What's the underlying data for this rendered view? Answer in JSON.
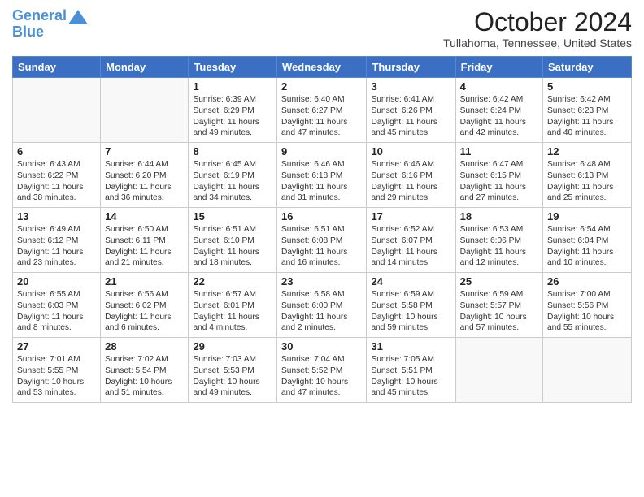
{
  "logo": {
    "line1": "General",
    "line2": "Blue"
  },
  "title": "October 2024",
  "location": "Tullahoma, Tennessee, United States",
  "days_of_week": [
    "Sunday",
    "Monday",
    "Tuesday",
    "Wednesday",
    "Thursday",
    "Friday",
    "Saturday"
  ],
  "weeks": [
    [
      {
        "day": "",
        "info": ""
      },
      {
        "day": "",
        "info": ""
      },
      {
        "day": "1",
        "info": "Sunrise: 6:39 AM\nSunset: 6:29 PM\nDaylight: 11 hours and 49 minutes."
      },
      {
        "day": "2",
        "info": "Sunrise: 6:40 AM\nSunset: 6:27 PM\nDaylight: 11 hours and 47 minutes."
      },
      {
        "day": "3",
        "info": "Sunrise: 6:41 AM\nSunset: 6:26 PM\nDaylight: 11 hours and 45 minutes."
      },
      {
        "day": "4",
        "info": "Sunrise: 6:42 AM\nSunset: 6:24 PM\nDaylight: 11 hours and 42 minutes."
      },
      {
        "day": "5",
        "info": "Sunrise: 6:42 AM\nSunset: 6:23 PM\nDaylight: 11 hours and 40 minutes."
      }
    ],
    [
      {
        "day": "6",
        "info": "Sunrise: 6:43 AM\nSunset: 6:22 PM\nDaylight: 11 hours and 38 minutes."
      },
      {
        "day": "7",
        "info": "Sunrise: 6:44 AM\nSunset: 6:20 PM\nDaylight: 11 hours and 36 minutes."
      },
      {
        "day": "8",
        "info": "Sunrise: 6:45 AM\nSunset: 6:19 PM\nDaylight: 11 hours and 34 minutes."
      },
      {
        "day": "9",
        "info": "Sunrise: 6:46 AM\nSunset: 6:18 PM\nDaylight: 11 hours and 31 minutes."
      },
      {
        "day": "10",
        "info": "Sunrise: 6:46 AM\nSunset: 6:16 PM\nDaylight: 11 hours and 29 minutes."
      },
      {
        "day": "11",
        "info": "Sunrise: 6:47 AM\nSunset: 6:15 PM\nDaylight: 11 hours and 27 minutes."
      },
      {
        "day": "12",
        "info": "Sunrise: 6:48 AM\nSunset: 6:13 PM\nDaylight: 11 hours and 25 minutes."
      }
    ],
    [
      {
        "day": "13",
        "info": "Sunrise: 6:49 AM\nSunset: 6:12 PM\nDaylight: 11 hours and 23 minutes."
      },
      {
        "day": "14",
        "info": "Sunrise: 6:50 AM\nSunset: 6:11 PM\nDaylight: 11 hours and 21 minutes."
      },
      {
        "day": "15",
        "info": "Sunrise: 6:51 AM\nSunset: 6:10 PM\nDaylight: 11 hours and 18 minutes."
      },
      {
        "day": "16",
        "info": "Sunrise: 6:51 AM\nSunset: 6:08 PM\nDaylight: 11 hours and 16 minutes."
      },
      {
        "day": "17",
        "info": "Sunrise: 6:52 AM\nSunset: 6:07 PM\nDaylight: 11 hours and 14 minutes."
      },
      {
        "day": "18",
        "info": "Sunrise: 6:53 AM\nSunset: 6:06 PM\nDaylight: 11 hours and 12 minutes."
      },
      {
        "day": "19",
        "info": "Sunrise: 6:54 AM\nSunset: 6:04 PM\nDaylight: 11 hours and 10 minutes."
      }
    ],
    [
      {
        "day": "20",
        "info": "Sunrise: 6:55 AM\nSunset: 6:03 PM\nDaylight: 11 hours and 8 minutes."
      },
      {
        "day": "21",
        "info": "Sunrise: 6:56 AM\nSunset: 6:02 PM\nDaylight: 11 hours and 6 minutes."
      },
      {
        "day": "22",
        "info": "Sunrise: 6:57 AM\nSunset: 6:01 PM\nDaylight: 11 hours and 4 minutes."
      },
      {
        "day": "23",
        "info": "Sunrise: 6:58 AM\nSunset: 6:00 PM\nDaylight: 11 hours and 2 minutes."
      },
      {
        "day": "24",
        "info": "Sunrise: 6:59 AM\nSunset: 5:58 PM\nDaylight: 10 hours and 59 minutes."
      },
      {
        "day": "25",
        "info": "Sunrise: 6:59 AM\nSunset: 5:57 PM\nDaylight: 10 hours and 57 minutes."
      },
      {
        "day": "26",
        "info": "Sunrise: 7:00 AM\nSunset: 5:56 PM\nDaylight: 10 hours and 55 minutes."
      }
    ],
    [
      {
        "day": "27",
        "info": "Sunrise: 7:01 AM\nSunset: 5:55 PM\nDaylight: 10 hours and 53 minutes."
      },
      {
        "day": "28",
        "info": "Sunrise: 7:02 AM\nSunset: 5:54 PM\nDaylight: 10 hours and 51 minutes."
      },
      {
        "day": "29",
        "info": "Sunrise: 7:03 AM\nSunset: 5:53 PM\nDaylight: 10 hours and 49 minutes."
      },
      {
        "day": "30",
        "info": "Sunrise: 7:04 AM\nSunset: 5:52 PM\nDaylight: 10 hours and 47 minutes."
      },
      {
        "day": "31",
        "info": "Sunrise: 7:05 AM\nSunset: 5:51 PM\nDaylight: 10 hours and 45 minutes."
      },
      {
        "day": "",
        "info": ""
      },
      {
        "day": "",
        "info": ""
      }
    ]
  ]
}
